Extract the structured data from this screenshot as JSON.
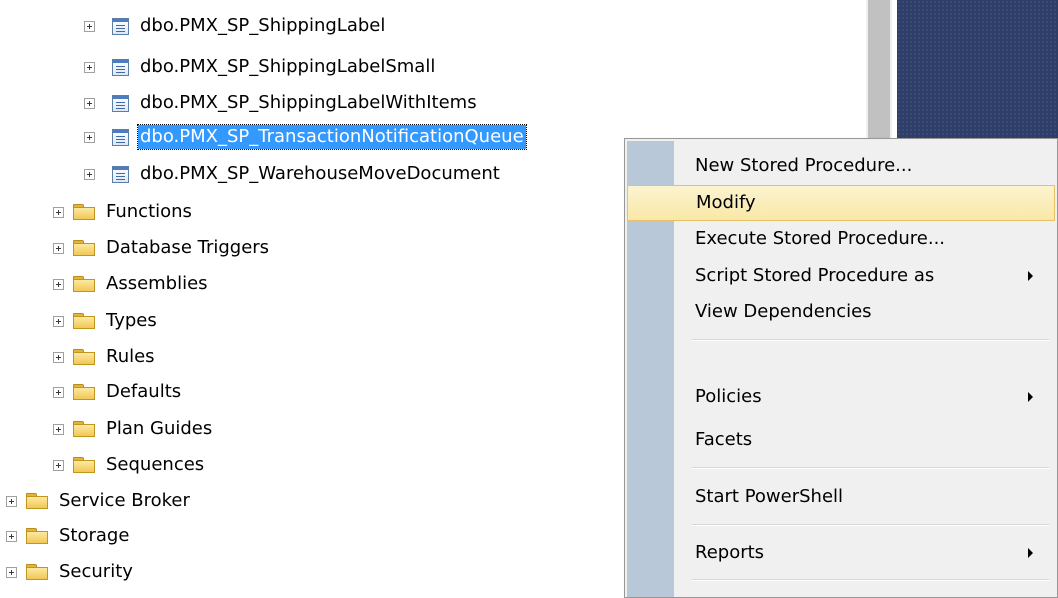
{
  "tree": {
    "stored_procedures": [
      {
        "label": "dbo.PMX_SP_ShippingLabel",
        "selected": false
      },
      {
        "label": "dbo.PMX_SP_ShippingLabelSmall",
        "selected": false
      },
      {
        "label": "dbo.PMX_SP_ShippingLabelWithItems",
        "selected": false
      },
      {
        "label": "dbo.PMX_SP_TransactionNotificationQueue",
        "selected": true
      },
      {
        "label": "dbo.PMX_SP_WarehouseMoveDocument",
        "selected": false
      }
    ],
    "programmability_folders": [
      {
        "label": "Functions"
      },
      {
        "label": "Database Triggers"
      },
      {
        "label": "Assemblies"
      },
      {
        "label": "Types"
      },
      {
        "label": "Rules"
      },
      {
        "label": "Defaults"
      },
      {
        "label": "Plan Guides"
      },
      {
        "label": "Sequences"
      }
    ],
    "database_folders": [
      {
        "label": "Service Broker"
      },
      {
        "label": "Storage"
      },
      {
        "label": "Security"
      }
    ]
  },
  "context_menu": {
    "items": [
      {
        "label": "New Stored Procedure...",
        "submenu": false,
        "highlighted": false
      },
      {
        "label": "Modify",
        "submenu": false,
        "highlighted": true
      },
      {
        "label": "Execute Stored Procedure...",
        "submenu": false,
        "highlighted": false
      },
      {
        "label": "Script Stored Procedure as",
        "submenu": true,
        "highlighted": false
      },
      {
        "label": "View Dependencies",
        "submenu": false,
        "highlighted": false
      },
      {
        "label": "Policies",
        "submenu": true,
        "highlighted": false
      },
      {
        "label": "Facets",
        "submenu": false,
        "highlighted": false
      },
      {
        "label": "Start PowerShell",
        "submenu": false,
        "highlighted": false
      },
      {
        "label": "Reports",
        "submenu": true,
        "highlighted": false
      }
    ]
  },
  "icons": {
    "expander": "plus-expander-icon",
    "stored_procedure": "stored-procedure-icon",
    "folder": "folder-icon",
    "submenu_arrow": "submenu-arrow-icon"
  },
  "colors": {
    "selection": "#3399ff",
    "menu_highlight": "#fcf0c0",
    "menu_gutter": "#b9c8d9",
    "dark_panel": "#2e3e66"
  }
}
